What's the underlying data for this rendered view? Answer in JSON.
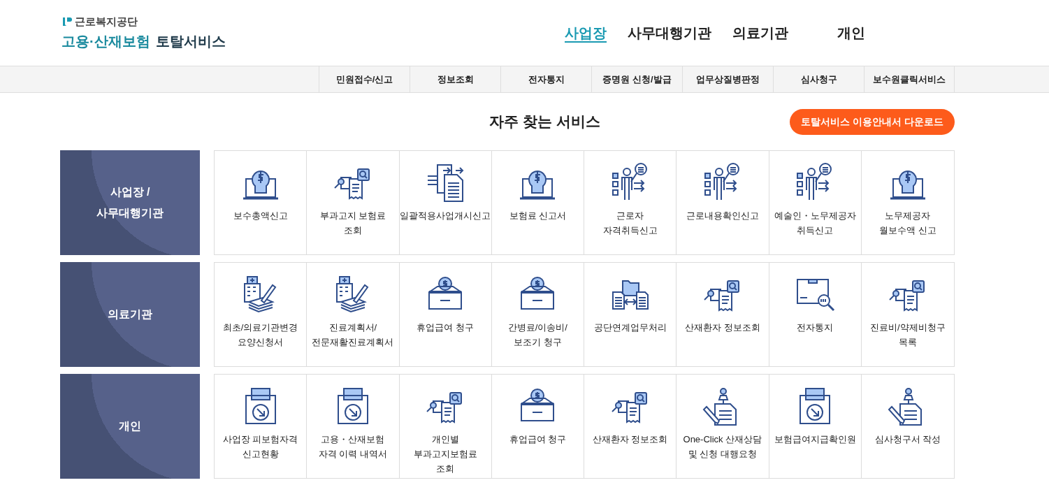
{
  "header": {
    "org": "근로복지공단",
    "title_main": "고용·산재보험",
    "title_sub": "토탈서비스"
  },
  "main_nav": [
    {
      "label": "사업장",
      "selected": true
    },
    {
      "label": "사무대행기관",
      "selected": false
    },
    {
      "label": "의료기관",
      "selected": false
    },
    {
      "label": "개인",
      "selected": false
    }
  ],
  "sub_nav": [
    "민원접수/신고",
    "정보조회",
    "전자통지",
    "증명원 신청/발급",
    "업무상질병판정",
    "심사청구",
    "보수원클릭서비스"
  ],
  "section": {
    "title": "자주 찾는 서비스",
    "download_button": "토탈서비스 이용안내서 다운로드"
  },
  "groups": [
    {
      "lines": [
        "사업장 /",
        "사무대행기관"
      ],
      "items": [
        {
          "label": "보수총액신고",
          "kind": "bulb"
        },
        {
          "label": "부과고지 보험료 조회",
          "kind": "docsearch"
        },
        {
          "label": "일괄적용사업개시신고",
          "kind": "transfer"
        },
        {
          "label": "보험료 신고서",
          "kind": "bulb"
        },
        {
          "label": "근로자 자격취득신고",
          "kind": "presenter"
        },
        {
          "label": "근로내용확인신고",
          "kind": "presenter"
        },
        {
          "label": "예술인・노무제공자 취득신고",
          "kind": "presenter"
        },
        {
          "label": "노무제공자 월보수액 신고",
          "kind": "bulb"
        }
      ]
    },
    {
      "lines": [
        "의료기관"
      ],
      "items": [
        {
          "label": "최초/의료기관변경 요양신청서",
          "kind": "hospital"
        },
        {
          "label": "진료계획서/전문재활진료계획서",
          "kind": "hospital"
        },
        {
          "label": "휴업급여 청구",
          "kind": "moneybox"
        },
        {
          "label": "간병료/이송비/보조기 청구",
          "kind": "moneybox"
        },
        {
          "label": "공단연계업무처리",
          "kind": "folder"
        },
        {
          "label": "산재환자 정보조회",
          "kind": "docsearch"
        },
        {
          "label": "전자통지",
          "kind": "parcel"
        },
        {
          "label": "진료비/약제비청구 목록",
          "kind": "docsearch"
        }
      ]
    },
    {
      "lines": [
        "개인"
      ],
      "items": [
        {
          "label": "사업장 피보험자격 신고현황",
          "kind": "printer"
        },
        {
          "label": "고용・산재보험 자격 이력 내역서",
          "kind": "printer"
        },
        {
          "label": "개인별 부과고지보험료 조회",
          "kind": "docsearch"
        },
        {
          "label": "휴업급여 청구",
          "kind": "moneybox"
        },
        {
          "label": "산재환자 정보조회",
          "kind": "docsearch"
        },
        {
          "label": "One-Click 산재상담 및 신청 대행요청",
          "kind": "pin"
        },
        {
          "label": "보험급여지급확인원",
          "kind": "printer"
        },
        {
          "label": "심사청구서 작성",
          "kind": "pin"
        }
      ]
    }
  ]
}
